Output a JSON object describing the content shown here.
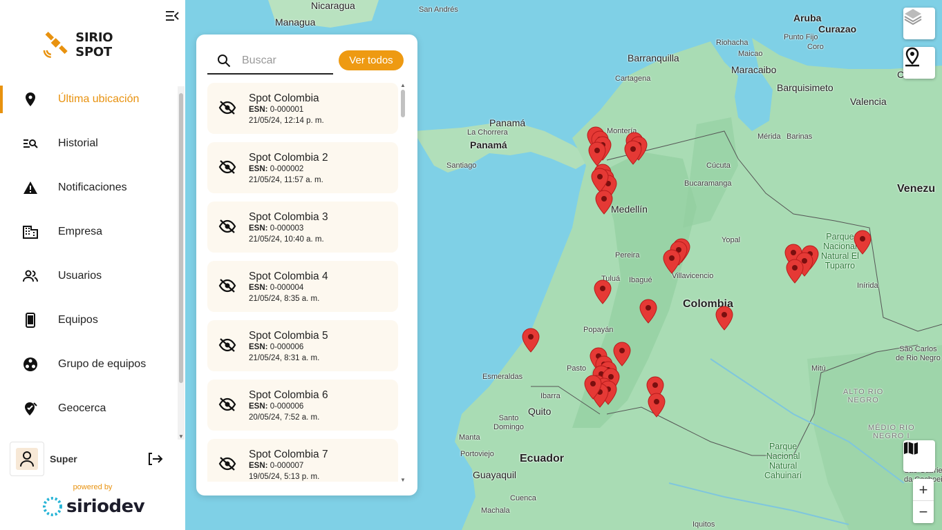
{
  "app": {
    "name": "SIRIO SPOT",
    "powered_by": "powered by",
    "vendor": "siriodev"
  },
  "sidebar": {
    "items": [
      {
        "label": "Última ubicación",
        "icon": "location-pin-icon",
        "active": true
      },
      {
        "label": "Historial",
        "icon": "history-search-icon",
        "active": false
      },
      {
        "label": "Notificaciones",
        "icon": "warning-icon",
        "active": false
      },
      {
        "label": "Empresa",
        "icon": "building-icon",
        "active": false
      },
      {
        "label": "Usuarios",
        "icon": "users-icon",
        "active": false
      },
      {
        "label": "Equipos",
        "icon": "phone-icon",
        "active": false
      },
      {
        "label": "Grupo de equipos",
        "icon": "group-icon",
        "active": false
      },
      {
        "label": "Geocerca",
        "icon": "geofence-icon",
        "active": false
      }
    ],
    "user": {
      "name": "Super"
    }
  },
  "panel": {
    "search": {
      "placeholder": "Buscar",
      "value": ""
    },
    "ver_todos": "Ver todos",
    "devices": [
      {
        "name": "Spot Colombia",
        "esn_label": "ESN:",
        "esn": "0-000001",
        "date": "21/05/24, 12:14 p. m."
      },
      {
        "name": "Spot Colombia 2",
        "esn_label": "ESN:",
        "esn": "0-000002",
        "date": "21/05/24, 11:57 a. m."
      },
      {
        "name": "Spot Colombia 3",
        "esn_label": "ESN:",
        "esn": "0-000003",
        "date": "21/05/24, 10:40 a. m."
      },
      {
        "name": "Spot Colombia 4",
        "esn_label": "ESN:",
        "esn": "0-000004",
        "date": "21/05/24, 8:35 a. m."
      },
      {
        "name": "Spot Colombia 5",
        "esn_label": "ESN:",
        "esn": "0-000006",
        "date": "21/05/24, 8:31 a. m."
      },
      {
        "name": "Spot Colombia 6",
        "esn_label": "ESN:",
        "esn": "0-000006",
        "date": "20/05/24, 7:52 a. m."
      },
      {
        "name": "Spot Colombia 7",
        "esn_label": "ESN:",
        "esn": "0-000007",
        "date": "19/05/24, 5:13 p. m."
      }
    ]
  },
  "map": {
    "labels": [
      {
        "text": "Nicaragua",
        "style": "mid"
      },
      {
        "text": "Managua",
        "style": "mid"
      },
      {
        "text": "San Andrés",
        "style": ""
      },
      {
        "text": "Aruba",
        "style": "mid"
      },
      {
        "text": "Curazao",
        "style": "mid"
      },
      {
        "text": "Punto Fijo",
        "style": ""
      },
      {
        "text": "Coro",
        "style": ""
      },
      {
        "text": "Riohacha",
        "style": ""
      },
      {
        "text": "Maicao",
        "style": ""
      },
      {
        "text": "Barranquilla",
        "style": "mid"
      },
      {
        "text": "Maracaibo",
        "style": "mid"
      },
      {
        "text": "Cartagena",
        "style": ""
      },
      {
        "text": "Barquisimeto",
        "style": "mid"
      },
      {
        "text": "Valencia",
        "style": "mid"
      },
      {
        "text": "Cara",
        "style": "mid"
      },
      {
        "text": "Panamá",
        "style": "mid"
      },
      {
        "text": "La Chorrera",
        "style": ""
      },
      {
        "text": "Panamá",
        "style": "big"
      },
      {
        "text": "Montería",
        "style": ""
      },
      {
        "text": "Mérida",
        "style": ""
      },
      {
        "text": "Barinas",
        "style": ""
      },
      {
        "text": "Santiago",
        "style": ""
      },
      {
        "text": "Cúcuta",
        "style": ""
      },
      {
        "text": "Bucaramanga",
        "style": ""
      },
      {
        "text": "Venezu",
        "style": "big"
      },
      {
        "text": "Medellín",
        "style": "mid"
      },
      {
        "text": "Yopal",
        "style": ""
      },
      {
        "text": "Pereira",
        "style": ""
      },
      {
        "text": "Tuluá",
        "style": ""
      },
      {
        "text": "Ibagué",
        "style": ""
      },
      {
        "text": "Villavicencio",
        "style": ""
      },
      {
        "text": "Colombia",
        "style": "big"
      },
      {
        "text": "Popayán",
        "style": ""
      },
      {
        "text": "Pasto",
        "style": ""
      },
      {
        "text": "Esmeraldas",
        "style": ""
      },
      {
        "text": "Ibarra",
        "style": ""
      },
      {
        "text": "Quito",
        "style": "mid"
      },
      {
        "text": "Santo\nDomingo",
        "style": ""
      },
      {
        "text": "Manta",
        "style": ""
      },
      {
        "text": "Portoviejo",
        "style": ""
      },
      {
        "text": "Ecuador",
        "style": "big"
      },
      {
        "text": "Guayaquil",
        "style": "mid"
      },
      {
        "text": "Cuenca",
        "style": ""
      },
      {
        "text": "Machala",
        "style": ""
      },
      {
        "text": "Iquitos",
        "style": ""
      },
      {
        "text": "Mitú",
        "style": ""
      },
      {
        "text": "Inírida",
        "style": ""
      },
      {
        "text": "São Gabriel\nda Cachoeira",
        "style": ""
      },
      {
        "text": "São Carlos\nde Rio Negro",
        "style": ""
      },
      {
        "text": "ALTO RIO\nNEGRO",
        "style": "dim"
      },
      {
        "text": "MÉDIO RIO\nNEGRO I",
        "style": "dim"
      },
      {
        "text": "Parque\nNacional\nNatural El\nTuparro",
        "style": "park"
      },
      {
        "text": "Parque\nNacional\nNatural\nCahuinarí",
        "style": "park"
      }
    ],
    "controls": {
      "layers": "layers-icon",
      "locate": "locate-pin-icon",
      "map_type": "map-icon",
      "zoom_in": "+",
      "zoom_out": "−"
    }
  },
  "colors": {
    "accent": "#e8920f",
    "marker": "#e53935",
    "water": "#7fd0e6",
    "land": "#a9dcb4"
  }
}
